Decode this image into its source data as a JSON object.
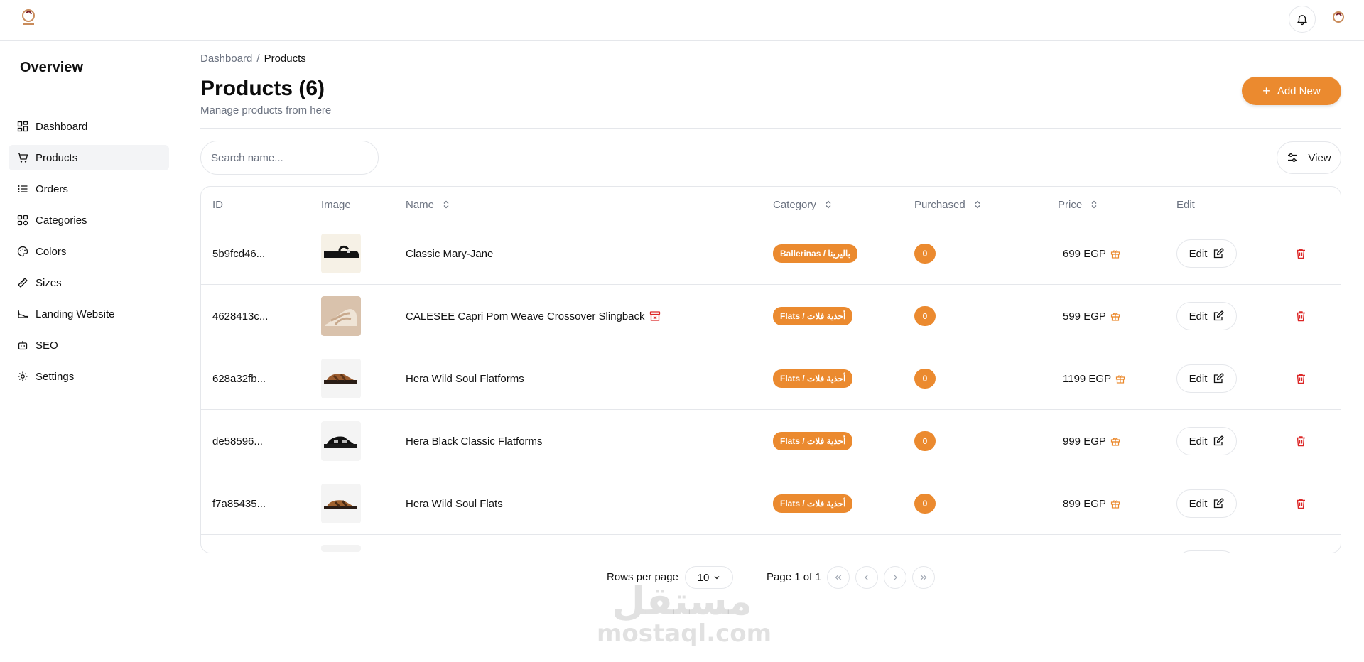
{
  "breadcrumb": {
    "parent": "Dashboard",
    "separator": "/",
    "current": "Products"
  },
  "sidebar": {
    "title": "Overview",
    "items": [
      {
        "label": "Dashboard",
        "icon": "dashboard-grid-icon",
        "active": false
      },
      {
        "label": "Products",
        "icon": "shopping-cart-icon",
        "active": true
      },
      {
        "label": "Orders",
        "icon": "list-icon",
        "active": false
      },
      {
        "label": "Categories",
        "icon": "categories-grid-icon",
        "active": false
      },
      {
        "label": "Colors",
        "icon": "palette-icon",
        "active": false
      },
      {
        "label": "Sizes",
        "icon": "ruler-icon",
        "active": false
      },
      {
        "label": "Landing Website",
        "icon": "shoe-icon",
        "active": false
      },
      {
        "label": "SEO",
        "icon": "robot-icon",
        "active": false
      },
      {
        "label": "Settings",
        "icon": "gear-icon",
        "active": false
      }
    ]
  },
  "header": {
    "title": "Products (6)",
    "subtitle": "Manage products from here",
    "add_button": "Add New"
  },
  "toolbar": {
    "search_placeholder": "Search name...",
    "view_button": "View"
  },
  "table": {
    "columns": [
      "ID",
      "Image",
      "Name",
      "Category",
      "Purchased",
      "Price",
      "Edit"
    ],
    "rows": [
      {
        "id": "5b9fcd46...",
        "name": "Classic Mary-Jane",
        "category": "Ballerinas / باليرينا",
        "purchased": "0",
        "price": "699 EGP",
        "edit": "Edit",
        "archived": false,
        "image": "shoe-black-maryjane"
      },
      {
        "id": "4628413c...",
        "name": "CALESEE Capri Pom Weave Crossover Slingback",
        "category": "Flats / أحذية فلات",
        "purchased": "0",
        "price": "599 EGP",
        "edit": "Edit",
        "archived": true,
        "image": "shoe-beige-slingback"
      },
      {
        "id": "628a32fb...",
        "name": "Hera Wild Soul Flatforms",
        "category": "Flats / أحذية فلات",
        "purchased": "0",
        "price": "1199 EGP",
        "edit": "Edit",
        "archived": false,
        "image": "shoe-brown-flatform"
      },
      {
        "id": "de58596...",
        "name": "Hera Black Classic Flatforms",
        "category": "Flats / أحذية فلات",
        "purchased": "0",
        "price": "999 EGP",
        "edit": "Edit",
        "archived": false,
        "image": "shoe-black-flatform"
      },
      {
        "id": "f7a85435...",
        "name": "Hera Wild Soul Flats",
        "category": "Flats / أحذية فلات",
        "purchased": "0",
        "price": "899 EGP",
        "edit": "Edit",
        "archived": false,
        "image": "shoe-brown-flat"
      }
    ]
  },
  "pagination": {
    "rows_label": "Rows per page",
    "rows_value": "10",
    "page_info": "Page 1 of 1"
  },
  "watermark": {
    "arabic": "مستقل",
    "latin": "mostaql.com"
  },
  "colors": {
    "accent": "#eb8a2f",
    "danger": "#dc2626",
    "border": "#e5e7eb",
    "muted": "#6b7280"
  }
}
